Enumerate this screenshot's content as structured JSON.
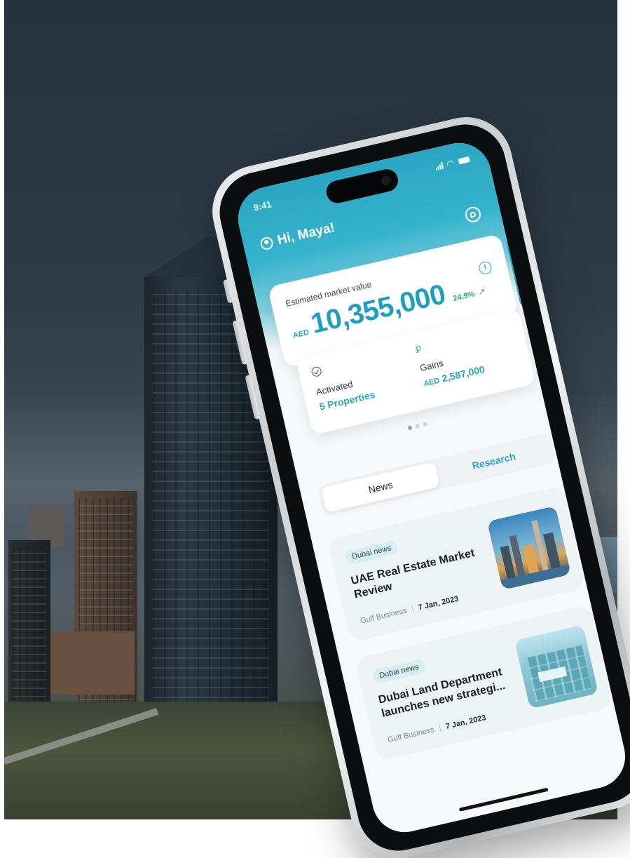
{
  "status_bar": {
    "time": "9:41"
  },
  "header": {
    "greeting": "Hi, Maya!"
  },
  "market_value": {
    "label": "Estimated market value",
    "currency": "AED",
    "amount": "10,355,000",
    "change": "24.9%"
  },
  "stats": {
    "activated": {
      "label": "Activated",
      "value": "5 Properties"
    },
    "gains": {
      "label": "Gains",
      "currency": "AED",
      "value": "2,587,000"
    }
  },
  "carousel": {
    "pages": 3,
    "active": 0
  },
  "tabs": [
    {
      "label": "News",
      "active": true
    },
    {
      "label": "Research",
      "active": false
    }
  ],
  "news": [
    {
      "tag": "Dubai news",
      "title": "UAE Real Estate Market Review",
      "source": "Gulf Business",
      "date": "7 Jan, 2023"
    },
    {
      "tag": "Dubai news",
      "title": "Dubai Land Department launches new strategi...",
      "source": "Gulf Business",
      "date": "7 Jan, 2023"
    }
  ],
  "colors": {
    "brand": "#2aa6c2",
    "positive": "#27b36a"
  }
}
